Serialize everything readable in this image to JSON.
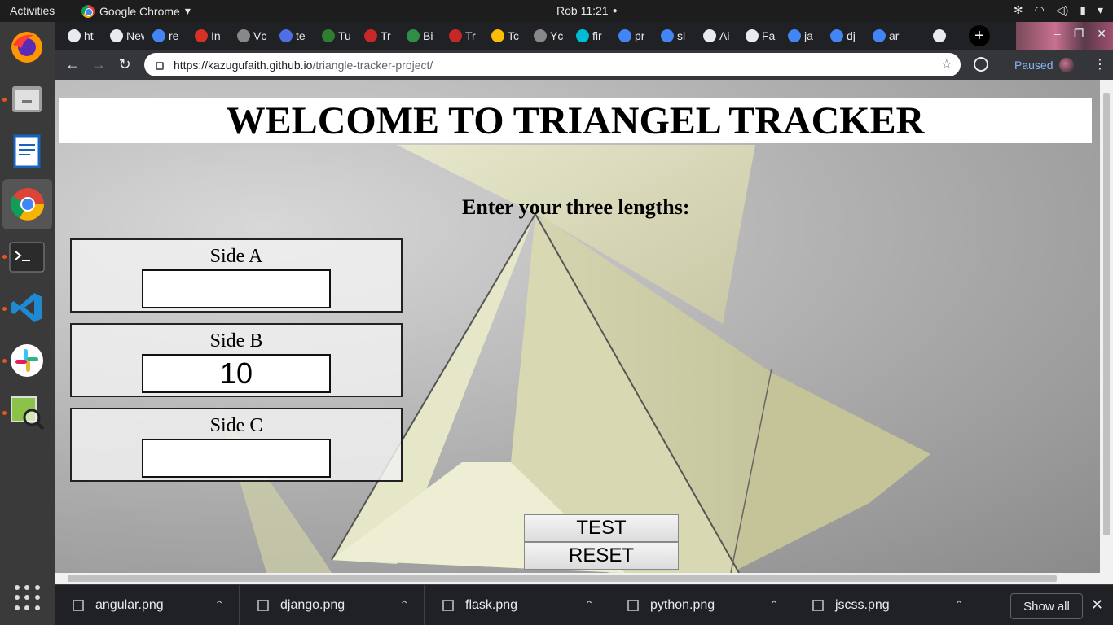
{
  "topbar": {
    "activities": "Activities",
    "app_name": "Google Chrome",
    "clock": "Rob 11:21"
  },
  "browser": {
    "tabs": [
      "ht",
      "New",
      "re",
      "In",
      "Vc",
      "te",
      "Tu",
      "Tr",
      "Bi",
      "Tr",
      "Tc",
      "Yc",
      "fir",
      "pr",
      "sl",
      "Ai",
      "Fa",
      "ja",
      "dj",
      "ar"
    ],
    "url_host": "https://kazugufaith.github.io",
    "url_path": "/triangle-tracker-project/",
    "profile_status": "Paused"
  },
  "page": {
    "heading": "WELCOME TO TRIANGEL TRACKER",
    "prompt": "Enter your three lengths:",
    "sides": [
      {
        "label": "Side A",
        "value": ""
      },
      {
        "label": "Side B",
        "value": "10"
      },
      {
        "label": "Side C",
        "value": ""
      }
    ],
    "test_label": "TEST",
    "reset_label": "RESET"
  },
  "downloads": {
    "items": [
      "angular.png",
      "django.png",
      "flask.png",
      "python.png",
      "jscss.png"
    ],
    "show_all": "Show all"
  }
}
